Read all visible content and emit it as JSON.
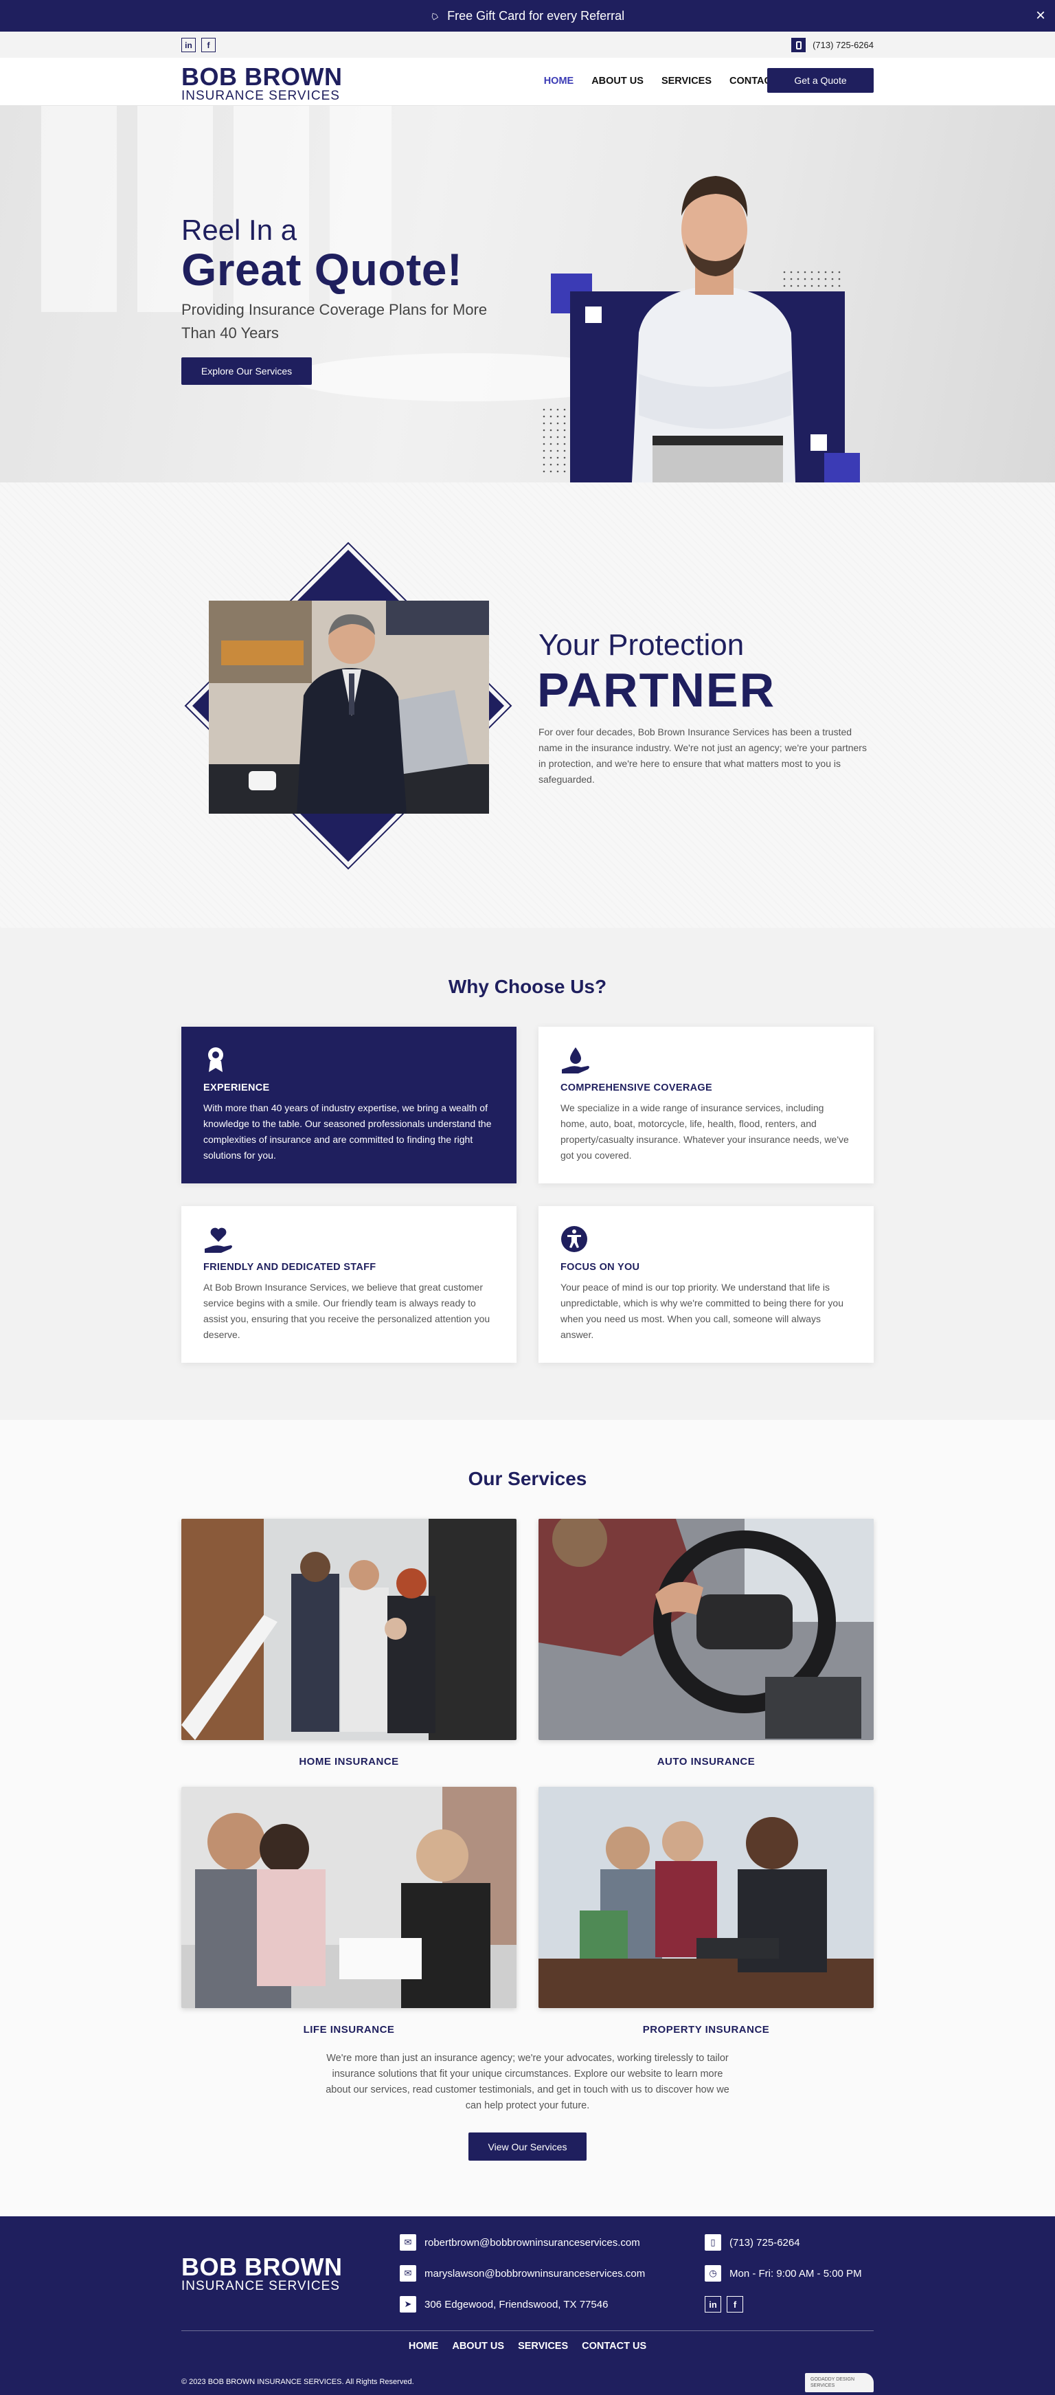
{
  "announcement": {
    "text": "Free Gift Card for every Referral",
    "close": "×"
  },
  "utility": {
    "social": [
      "in",
      "f"
    ],
    "phone": "(713) 725-6264"
  },
  "header": {
    "logo_line1": "BOB BROWN",
    "logo_line2": "INSURANCE SERVICES",
    "nav": [
      "HOME",
      "ABOUT US",
      "SERVICES",
      "CONTACT US"
    ],
    "quote_button": "Get a Quote"
  },
  "hero": {
    "line1": "Reel In a",
    "line2": "Great Quote!",
    "subtitle": "Providing Insurance Coverage Plans for More Than 40 Years",
    "button": "Explore Our Services"
  },
  "partner": {
    "title1": "Your Protection",
    "title2": "PARTNER",
    "description": "For over four decades, Bob Brown Insurance Services has been a trusted name in the insurance industry. We're not just an agency; we're your partners in protection, and we're here to ensure that what matters most to you is safeguarded."
  },
  "why": {
    "title": "Why Choose Us?",
    "cards": [
      {
        "title": "EXPERIENCE",
        "icon": "award-icon",
        "text": "With more than 40 years of industry expertise, we bring a wealth of knowledge to the table. Our seasoned professionals understand the complexities of insurance and are committed to finding the right solutions for you."
      },
      {
        "title": "COMPREHENSIVE COVERAGE",
        "icon": "hand-drop-icon",
        "text": "We specialize in a wide range of insurance services, including home, auto, boat, motorcycle, life, health, flood, renters, and property/casualty insurance. Whatever your insurance needs, we've got you covered."
      },
      {
        "title": "FRIENDLY AND DEDICATED STAFF",
        "icon": "hand-heart-icon",
        "text": "At Bob Brown Insurance Services, we believe that great customer service begins with a smile. Our friendly team is always ready to assist you, ensuring that you receive the personalized attention you deserve."
      },
      {
        "title": "FOCUS ON YOU",
        "icon": "accessibility-icon",
        "text": "Your peace of mind is our top priority. We understand that life is unpredictable, which is why we're committed to being there for you when you need us most. When you call, someone will always answer."
      }
    ]
  },
  "services": {
    "title": "Our Services",
    "items": [
      {
        "label": "HOME INSURANCE"
      },
      {
        "label": "AUTO INSURANCE"
      },
      {
        "label": "LIFE INSURANCE"
      },
      {
        "label": "PROPERTY INSURANCE"
      }
    ],
    "paragraph": "We're more than just an insurance agency; we're your advocates, working tirelessly to tailor insurance solutions that fit your unique circumstances. Explore our website to learn more about our services, read customer testimonials, and get in touch with us to discover how we can help protect your future.",
    "button": "View Our Services"
  },
  "footer": {
    "logo_line1": "BOB BROWN",
    "logo_line2": "INSURANCE SERVICES",
    "email1": "robertbrown@bobbrowninsuranceservices.com",
    "email2": "maryslawson@bobbrowninsuranceservices.com",
    "address": "306 Edgewood, Friendswood, TX 77546",
    "phone": "(713) 725-6264",
    "hours": "Mon - Fri: 9:00 AM - 5:00 PM",
    "social": [
      "in",
      "f"
    ],
    "nav": [
      "HOME",
      "ABOUT US",
      "SERVICES",
      "CONTACT US"
    ],
    "copyright": "© 2023 BOB BROWN INSURANCE SERVICES. All Rights Reserved.",
    "badge": "GODADDY DESIGN SERVICES"
  },
  "colors": {
    "brand": "#1f1f5e",
    "accent": "#3b3bb5",
    "background": "#f2f2f2"
  }
}
